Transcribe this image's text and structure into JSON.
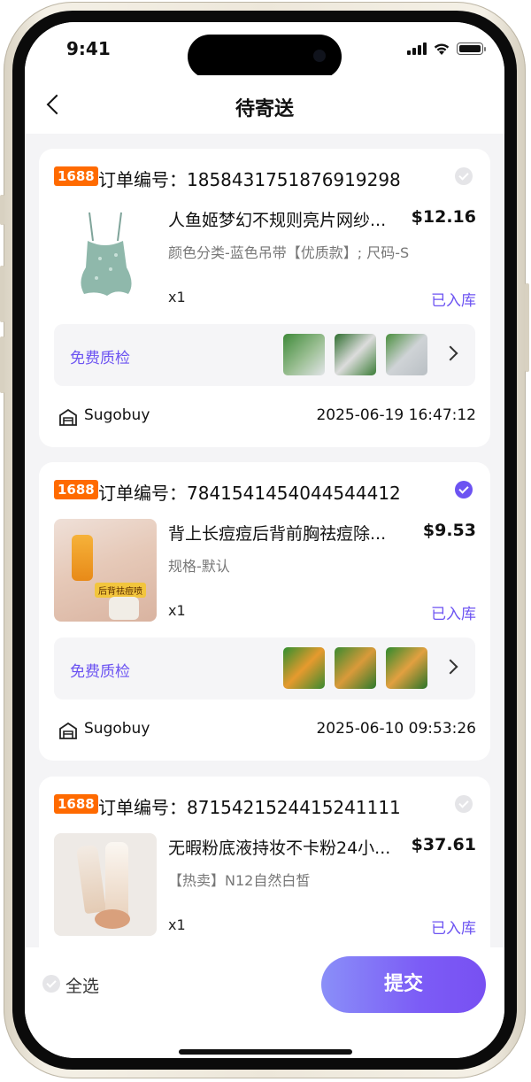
{
  "status_bar": {
    "time": "9:41"
  },
  "nav": {
    "title": "待寄送"
  },
  "orders": [
    {
      "badge": "1688",
      "order_label": "订单编号：1858431751876919298",
      "checked": false,
      "product_title": "人鱼姬梦幻不规则亮片网纱...",
      "price": "$12.16",
      "spec": "颜色分类-蓝色吊带【优质款】; 尺码-S",
      "quantity": "x1",
      "status": "已入库",
      "qc_label": "免费质检",
      "store_name": "Sugobuy",
      "date": "2025-06-19 16:47:12"
    },
    {
      "badge": "1688",
      "order_label": "订单编号：7841541454044544412",
      "checked": true,
      "product_title": "背上长痘痘后背前胸祛痘除...",
      "price": "$9.53",
      "spec": "规格-默认",
      "quantity": "x1",
      "status": "已入库",
      "qc_label": "免费质检",
      "store_name": "Sugobuy",
      "date": "2025-06-10 09:53:26",
      "thumb_text": "后背祛痘喷"
    },
    {
      "badge": "1688",
      "order_label": "订单编号：8715421524415241111",
      "checked": false,
      "product_title": "无暇粉底液持妆不卡粉24小...",
      "price": "$37.61",
      "spec": "【热卖】N12自然白皙",
      "quantity": "x1",
      "status": "已入库"
    }
  ],
  "footer": {
    "select_all": "全选",
    "submit": "提交"
  },
  "colors": {
    "accent": "#6c53f2",
    "badge": "#ff6a00",
    "background": "#f4f4f6"
  }
}
